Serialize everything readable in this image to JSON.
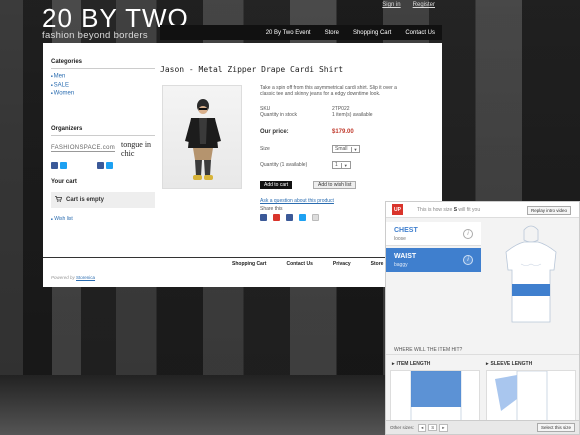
{
  "brand": {
    "title": "20 BY TWO",
    "subtitle": "fashion beyond borders"
  },
  "top_links": [
    "Sign in",
    "Register"
  ],
  "nav": [
    "20 By Two Event",
    "Store",
    "Shopping Cart",
    "Contact Us"
  ],
  "sidebar": {
    "categories_title": "Categories",
    "categories": [
      "Men",
      "SALE",
      "Women"
    ],
    "organizers_title": "Organizers",
    "organizers": [
      "FASHIONSPACE.com",
      "tongue in chic"
    ],
    "cart_title": "Your cart",
    "cart_status": "Cart is empty",
    "wishlist": "Wish list"
  },
  "product": {
    "title": "Jason - Metal Zipper Drape Cardi Shirt",
    "description": "Take a spin off from this asymmetrical cardi shirt. Slip it over a classic tee and skinny jeans for a edgy downtime look.",
    "sku_label": "SKU",
    "sku": "2TP022",
    "stock_label": "Quantity in stock",
    "stock": "1 item(s) available",
    "price_label": "Our price:",
    "price": "$179.00",
    "size_label": "Size",
    "size_value": "Small",
    "qty_label": "Quantity (1 available)",
    "qty_value": "1",
    "add_to_cart": "Add to cart",
    "add_to_wishlist": "Add to wish list",
    "ask": "Ask a question about this product",
    "share": "Share this"
  },
  "footer": {
    "links": [
      "Shopping Cart",
      "Contact Us",
      "Privacy",
      "Store Po"
    ],
    "powered_prefix": "Powered by",
    "powered_link": "Storenica",
    "copyright": "Copyr"
  },
  "widget": {
    "logo": "UP",
    "title_pre": "This is how size",
    "title_size": "S",
    "title_post": "will fit you",
    "replay": "Replay intro video",
    "chest_label": "CHEST",
    "chest_fit": "loose",
    "waist_label": "WAIST",
    "waist_fit": "baggy",
    "where_hit": "WHERE WILL THE ITEM HIT?",
    "item_length": "ITEM LENGTH",
    "sleeve_length": "SLEEVE LENGTH",
    "other_sizes": "Other sizes:",
    "size_value": "S",
    "select_btn": "Select this size"
  },
  "colors": {
    "accent_blue": "#3f7fce",
    "price_red": "#c0392b",
    "widget_red": "#d9342b",
    "facebook": "#3b5998",
    "twitter": "#1da1f2"
  }
}
